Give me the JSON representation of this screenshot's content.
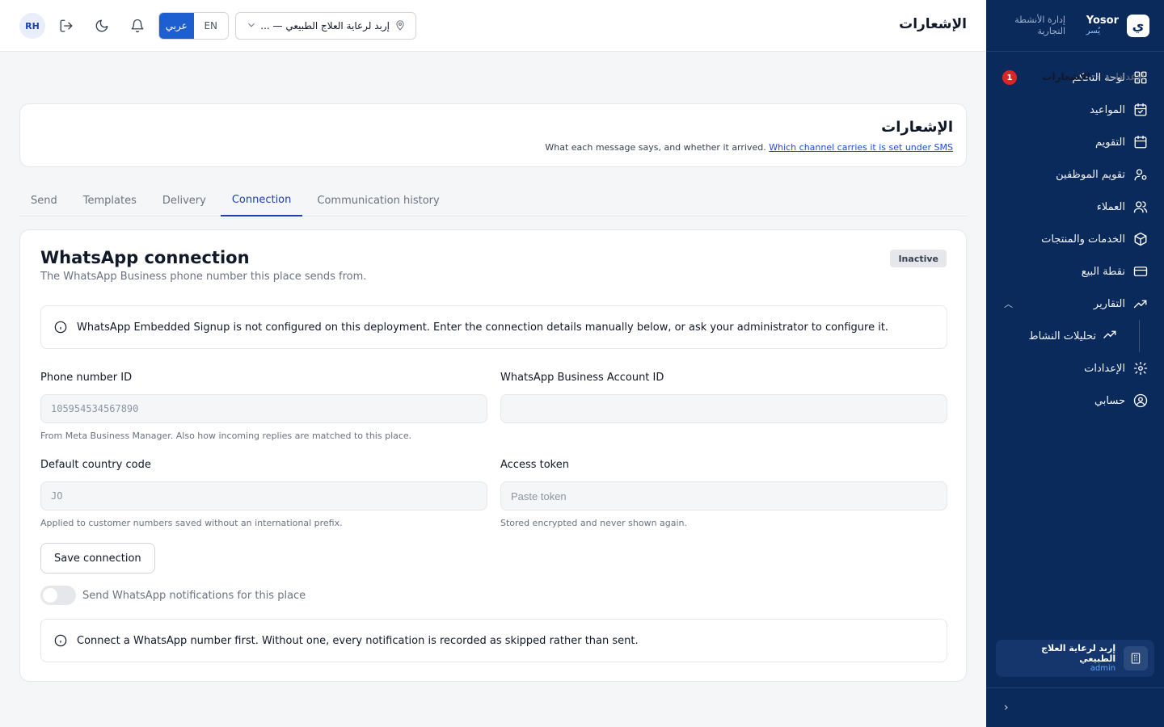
{
  "brand": {
    "logo_letter": "ي",
    "name_en": "Yosor",
    "name_ar": "يُسر",
    "subtitle": "إدارة الأنشطة التجارية"
  },
  "sidebar": {
    "items": [
      {
        "label": "لوحة التحكم",
        "icon": "dashboard-icon",
        "badge": "1"
      },
      {
        "label": "المواعيد",
        "icon": "calendar-check-icon"
      },
      {
        "label": "التقويم",
        "icon": "calendar-icon"
      },
      {
        "label": "تقويم الموظفين",
        "icon": "user-gear-icon"
      },
      {
        "label": "العملاء",
        "icon": "users-icon"
      },
      {
        "label": "الخدمات والمنتجات",
        "icon": "box-icon"
      },
      {
        "label": "نقطة البيع",
        "icon": "credit-card-icon"
      },
      {
        "label": "التقارير",
        "icon": "trending-up-icon",
        "expanded": true
      }
    ],
    "sub_items": [
      {
        "label": "تحليلات النشاط",
        "icon": "trending-up-icon"
      }
    ],
    "bottom_items": [
      {
        "label": "الإعدادات",
        "icon": "gear-icon"
      },
      {
        "label": "حسابي",
        "icon": "user-circle-icon"
      }
    ],
    "clinic": {
      "name": "إربد لرعاية العلاج الطبيعي",
      "role": "admin"
    }
  },
  "topbar": {
    "avatar_initials": "RH",
    "lang_ar": "عربي",
    "lang_en": "EN",
    "location": "إربد لرعاية العلاج الطبيعي — ...",
    "page_title": "الإشعارات"
  },
  "breadcrumb": {
    "parent": "الإعدادات",
    "current": "الإشعارات"
  },
  "header": {
    "title": "الإشعارات",
    "desc_text": "What each message says, and whether it arrived.",
    "desc_link": "Which channel carries it is set under SMS"
  },
  "tabs": [
    {
      "label": "Send",
      "active": false
    },
    {
      "label": "Templates",
      "active": false
    },
    {
      "label": "Delivery",
      "active": false
    },
    {
      "label": "Connection",
      "active": true
    },
    {
      "label": "Communication history",
      "active": false
    }
  ],
  "connection": {
    "title": "WhatsApp connection",
    "subtitle": "The WhatsApp Business phone number this place sends from.",
    "status": "Inactive",
    "alert_signup": "WhatsApp Embedded Signup is not configured on this deployment. Enter the connection details manually below, or ask your administrator to configure it.",
    "phone_id": {
      "label": "Phone number ID",
      "placeholder": "105954534567890",
      "value": "",
      "hint": "From Meta Business Manager. Also how incoming replies are matched to this place."
    },
    "waba_id": {
      "label": "WhatsApp Business Account ID",
      "placeholder": "",
      "value": ""
    },
    "country_code": {
      "label": "Default country code",
      "placeholder": "JO",
      "value": "",
      "hint": "Applied to customer numbers saved without an international prefix."
    },
    "access_token": {
      "label": "Access token",
      "placeholder": "Paste token",
      "value": "",
      "hint": "Stored encrypted and never shown again."
    },
    "save_label": "Save connection",
    "toggle_label": "Send WhatsApp notifications for this place",
    "toggle_on": false,
    "alert_connect": "Connect a WhatsApp number first. Without one, every notification is recorded as skipped rather than sent."
  },
  "colors": {
    "sidebar_bg": "#0b2a5c",
    "accent": "#1d5fd1",
    "badge_red": "#dc2626"
  }
}
